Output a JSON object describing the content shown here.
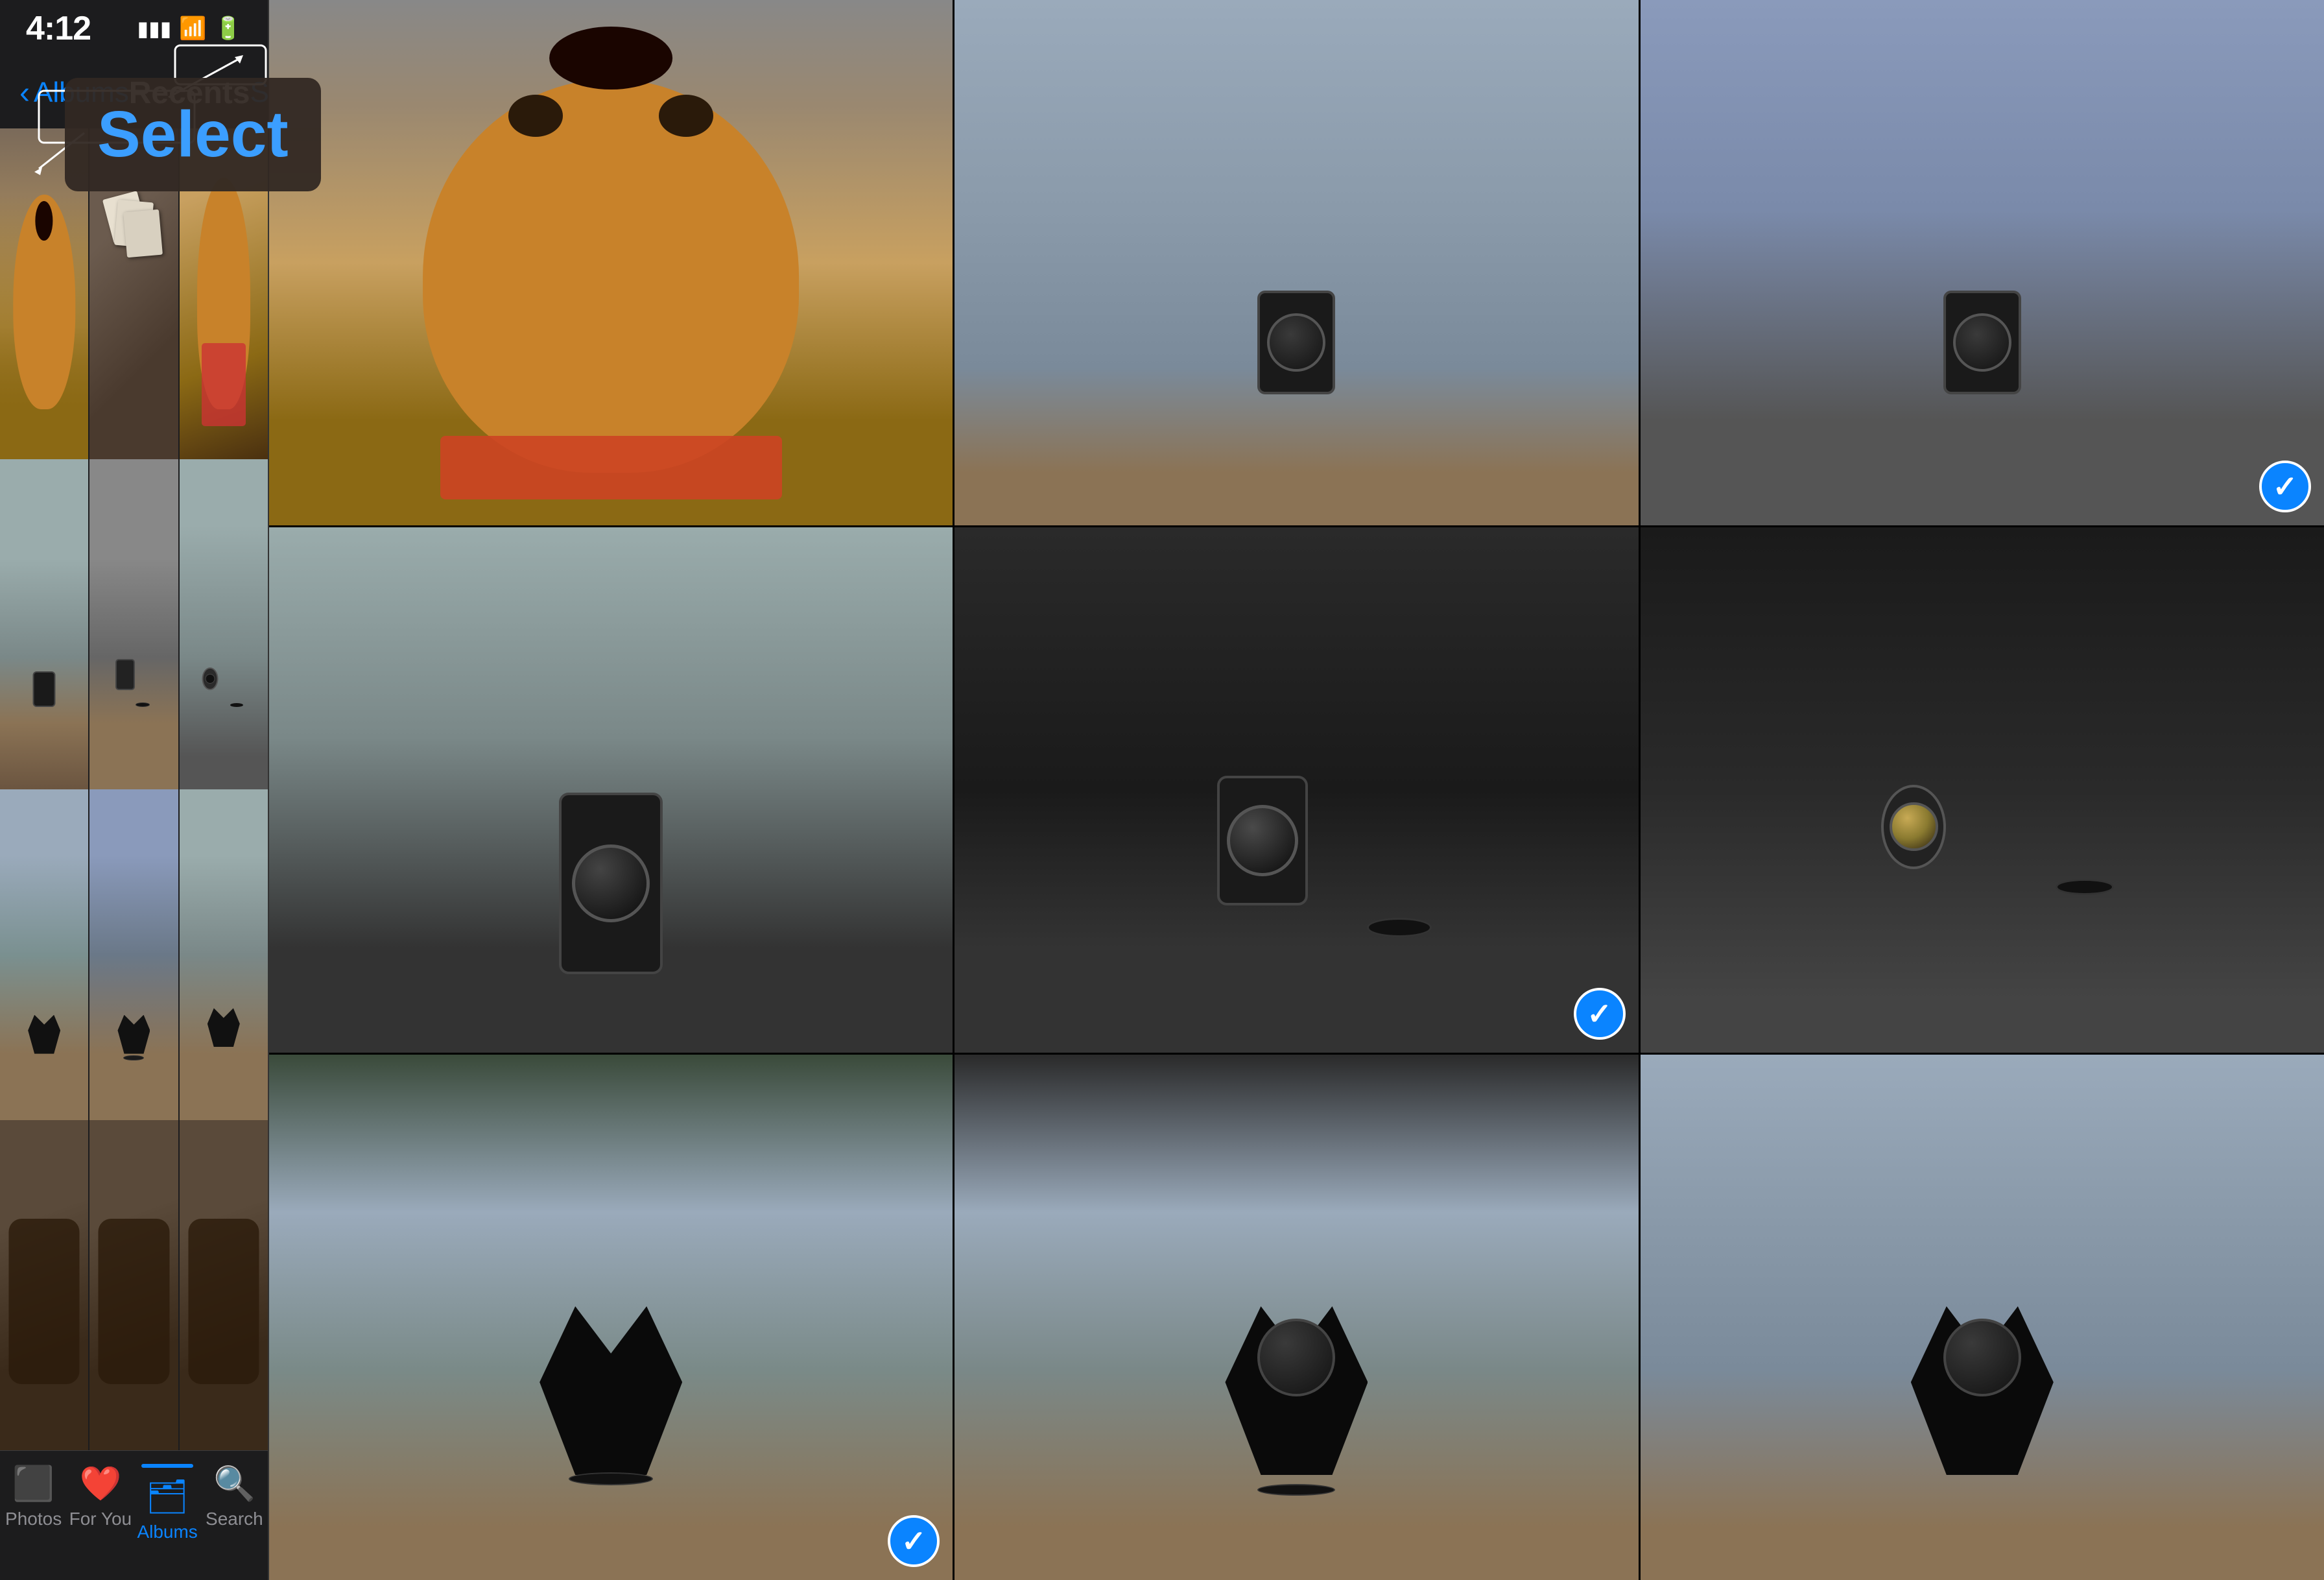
{
  "phone": {
    "statusBar": {
      "time": "4:12",
      "icons": [
        "signal",
        "wifi",
        "battery"
      ]
    },
    "navBar": {
      "backLabel": "Albums",
      "title": "Recents",
      "selectLabel": "Select"
    },
    "selectTooltip": {
      "text": "Select"
    },
    "tabs": [
      {
        "id": "photos",
        "label": "Photos",
        "icon": "🖼",
        "active": false
      },
      {
        "id": "for-you",
        "label": "For You",
        "icon": "❤",
        "active": false
      },
      {
        "id": "albums",
        "label": "Albums",
        "icon": "🗂",
        "active": true
      },
      {
        "id": "search",
        "label": "Search",
        "icon": "🔍",
        "active": false
      }
    ]
  },
  "detailGrid": {
    "cells": [
      {
        "id": 0,
        "type": "dog",
        "hasCheck": false
      },
      {
        "id": 1,
        "type": "lens-table",
        "hasCheck": false
      },
      {
        "id": 2,
        "type": "lens-dark",
        "hasCheck": true
      },
      {
        "id": 3,
        "type": "lens-tall",
        "hasCheck": false
      },
      {
        "id": 4,
        "type": "lens-medium",
        "hasCheck": true
      },
      {
        "id": 5,
        "type": "lens-small-cap",
        "hasCheck": false
      },
      {
        "id": 6,
        "type": "lens-hood",
        "hasCheck": true
      },
      {
        "id": 7,
        "type": "lens-hood2",
        "hasCheck": false
      },
      {
        "id": 8,
        "type": "lens-hood3",
        "hasCheck": false
      }
    ]
  }
}
